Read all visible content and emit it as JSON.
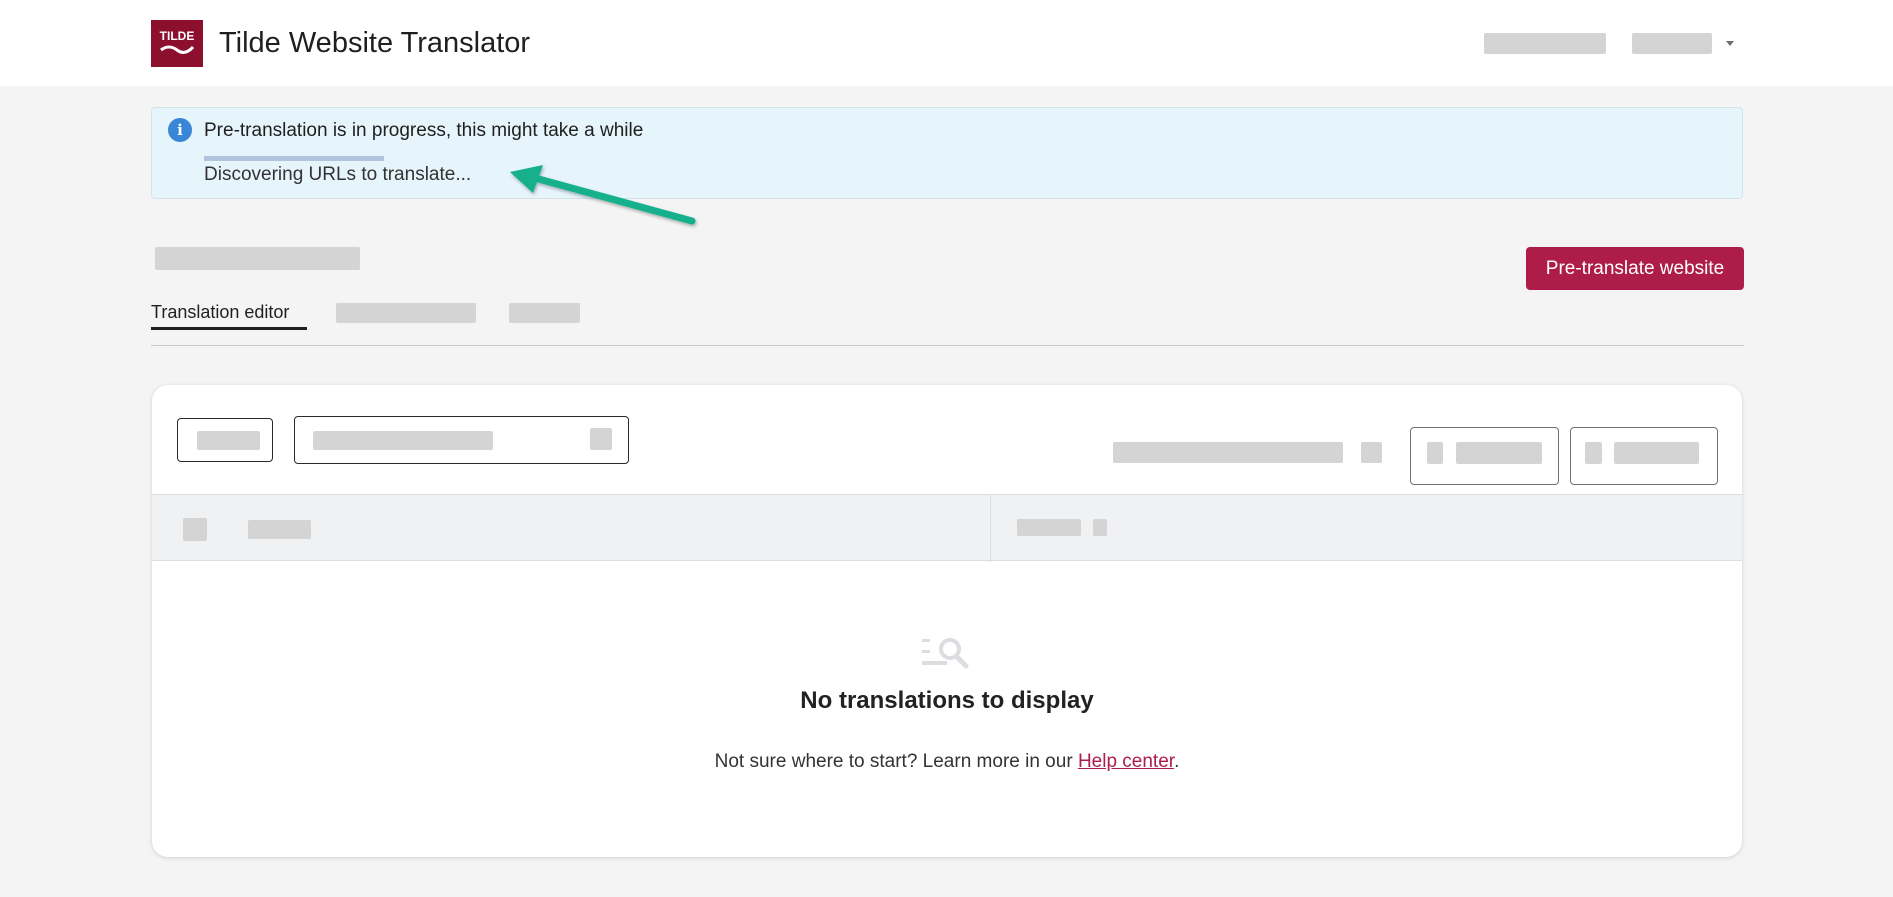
{
  "header": {
    "app_title": "Tilde Website Translator",
    "logo_text": "TILDE",
    "user_menu_icon": "caret-down-icon"
  },
  "banner": {
    "icon": "info-icon",
    "icon_glyph": "i",
    "title": "Pre-translation is in progress, this might take a while",
    "status": "Discovering URLs to translate...",
    "progress_percent": 100
  },
  "actions": {
    "pretranslate_label": "Pre-translate website"
  },
  "tabs": [
    {
      "label": "Translation editor",
      "active": true
    }
  ],
  "empty_state": {
    "icon": "search-list-icon",
    "title": "No translations to display",
    "subtitle_prefix": "Not sure where to start? Learn more in our ",
    "link_label": "Help center",
    "subtitle_suffix": "."
  },
  "colors": {
    "brand": "#ae1d4a",
    "logo": "#8c0f2e",
    "info": "#3a86d6",
    "banner_bg": "#e6f4fc",
    "annotation_arrow": "#12b08c"
  }
}
